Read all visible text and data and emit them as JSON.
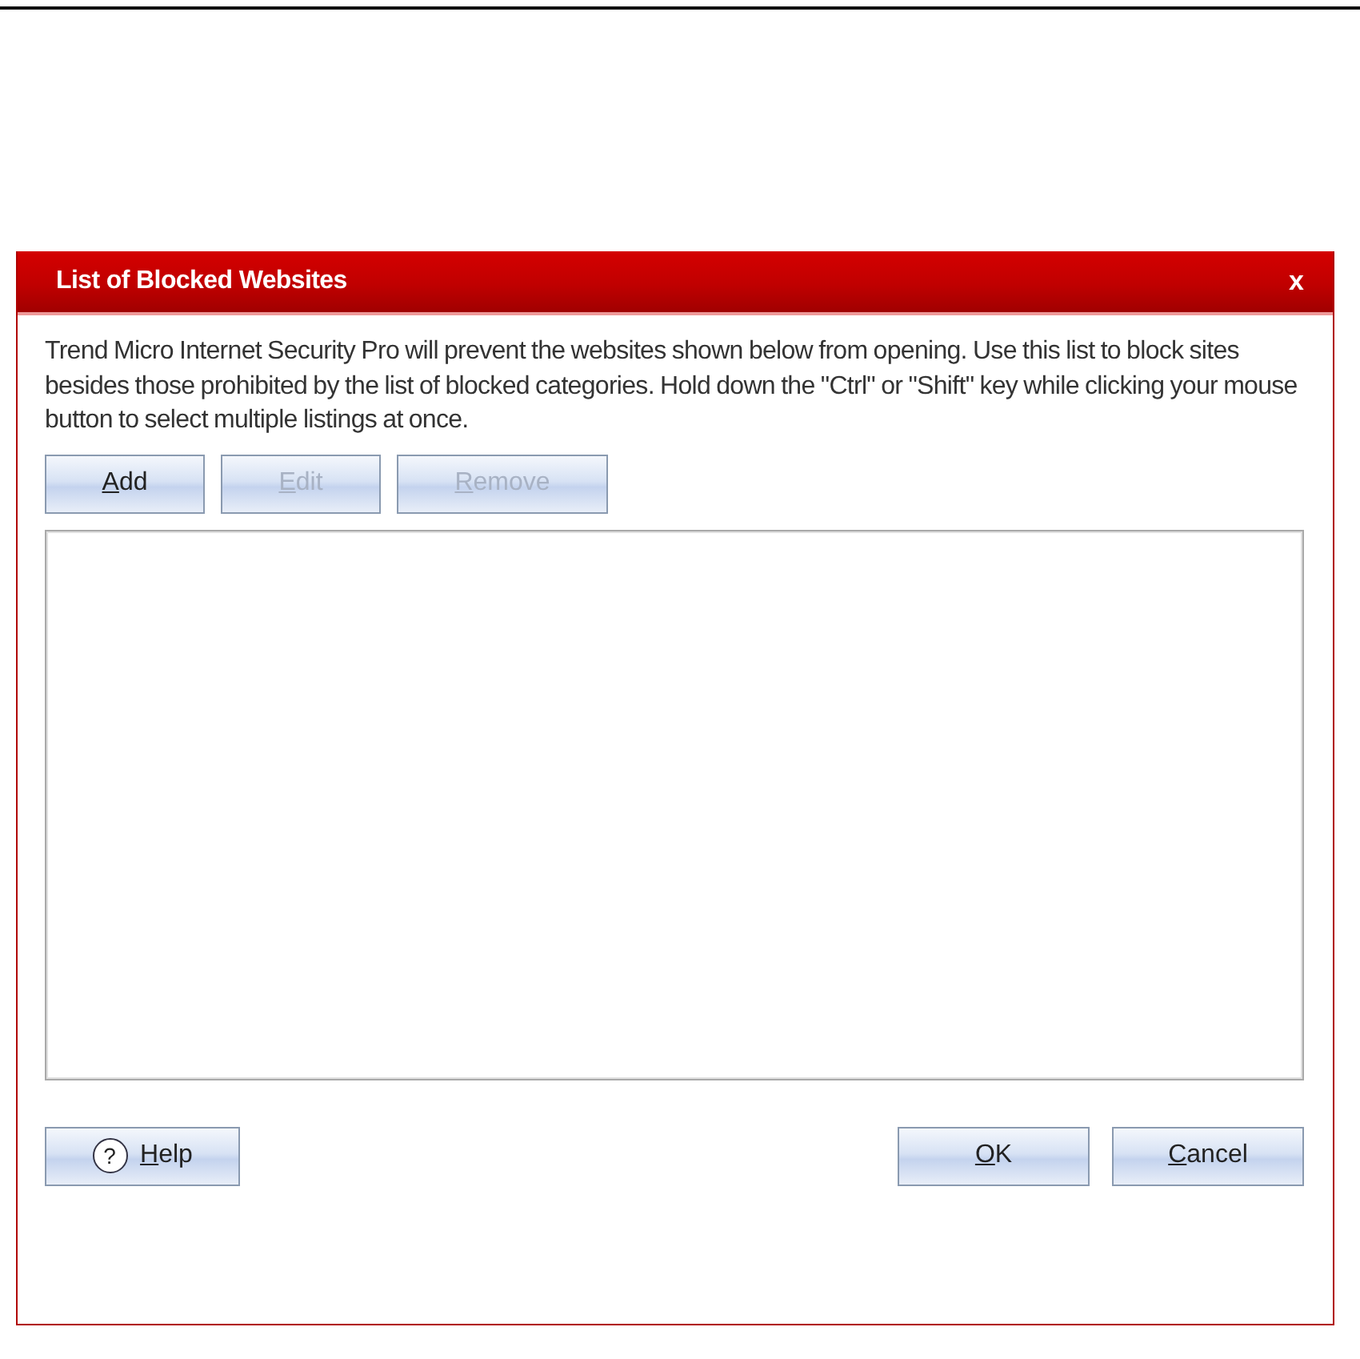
{
  "window": {
    "title": "List of Blocked Websites",
    "close": "x"
  },
  "description": "Trend Micro Internet Security Pro will prevent the websites shown below from opening. Use this list to block sites besides those prohibited by the list of blocked categories. Hold down the \"Ctrl\" or \"Shift\" key while clicking your mouse button to select multiple listings at once.",
  "toolbar": [
    {
      "label": "Add",
      "disabled": false
    },
    {
      "label": "Edit",
      "disabled": true
    },
    {
      "label": "Remove",
      "disabled": true
    }
  ],
  "help_button": {
    "label": "Help",
    "icon": "?"
  },
  "buttons": [
    {
      "label": "OK"
    },
    {
      "label": "Cancel"
    }
  ]
}
